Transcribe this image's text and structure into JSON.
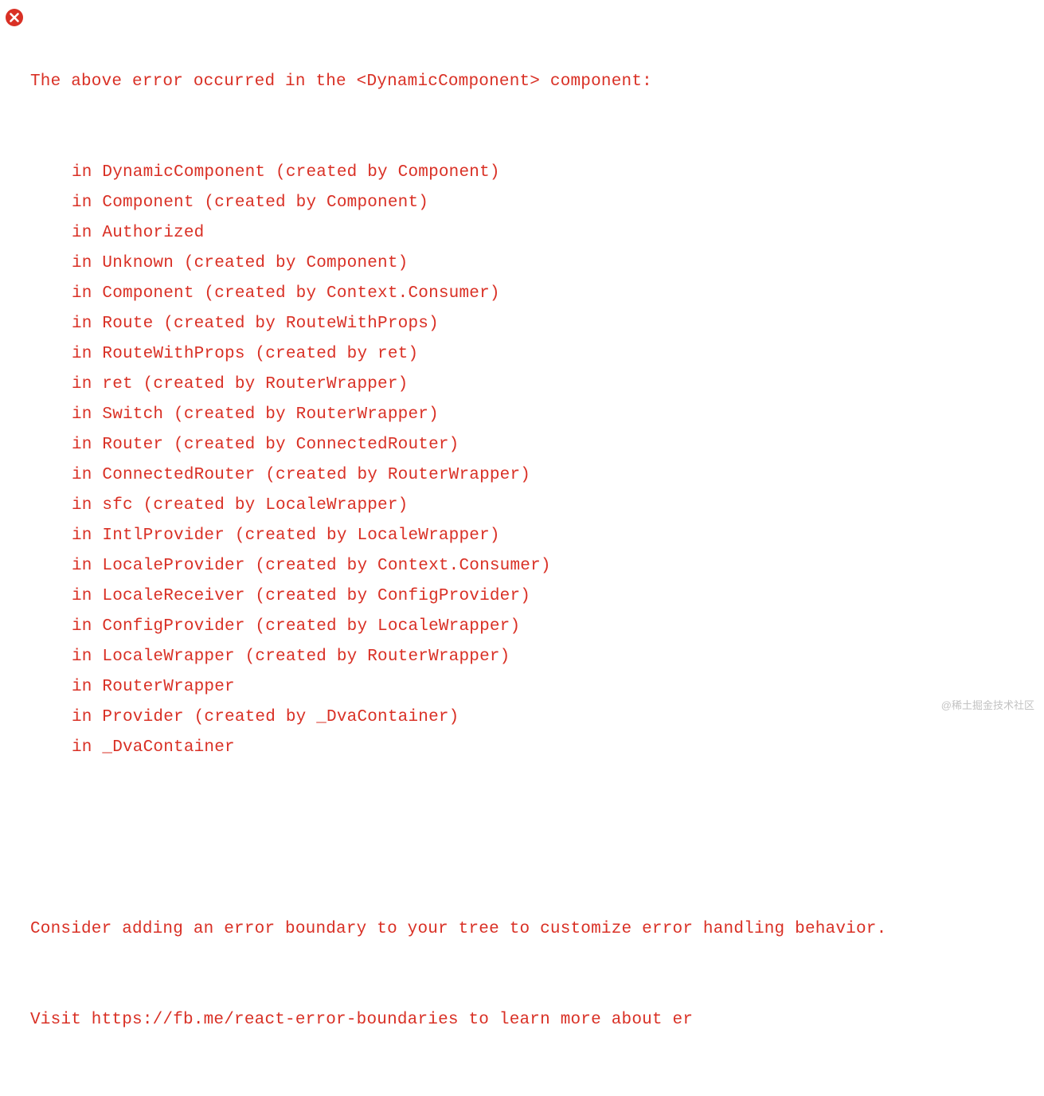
{
  "error": {
    "header": "The above error occurred in the <DynamicComponent> component:",
    "stack": [
      "in DynamicComponent (created by Component)",
      "in Component (created by Component)",
      "in Authorized",
      "in Unknown (created by Component)",
      "in Component (created by Context.Consumer)",
      "in Route (created by RouteWithProps)",
      "in RouteWithProps (created by ret)",
      "in ret (created by RouterWrapper)",
      "in Switch (created by RouterWrapper)",
      "in Router (created by ConnectedRouter)",
      "in ConnectedRouter (created by RouterWrapper)",
      "in sfc (created by LocaleWrapper)",
      "in IntlProvider (created by LocaleWrapper)",
      "in LocaleProvider (created by Context.Consumer)",
      "in LocaleReceiver (created by ConfigProvider)",
      "in ConfigProvider (created by LocaleWrapper)",
      "in LocaleWrapper (created by RouterWrapper)",
      "in RouterWrapper",
      "in Provider (created by _DvaContainer)",
      "in _DvaContainer"
    ],
    "hint_line1": "Consider adding an error boundary to your tree to customize error handling behavior.",
    "hint_line2": "Visit https://fb.me/react-error-boundaries to learn more about er"
  },
  "watermark": "@稀土掘金技术社区"
}
